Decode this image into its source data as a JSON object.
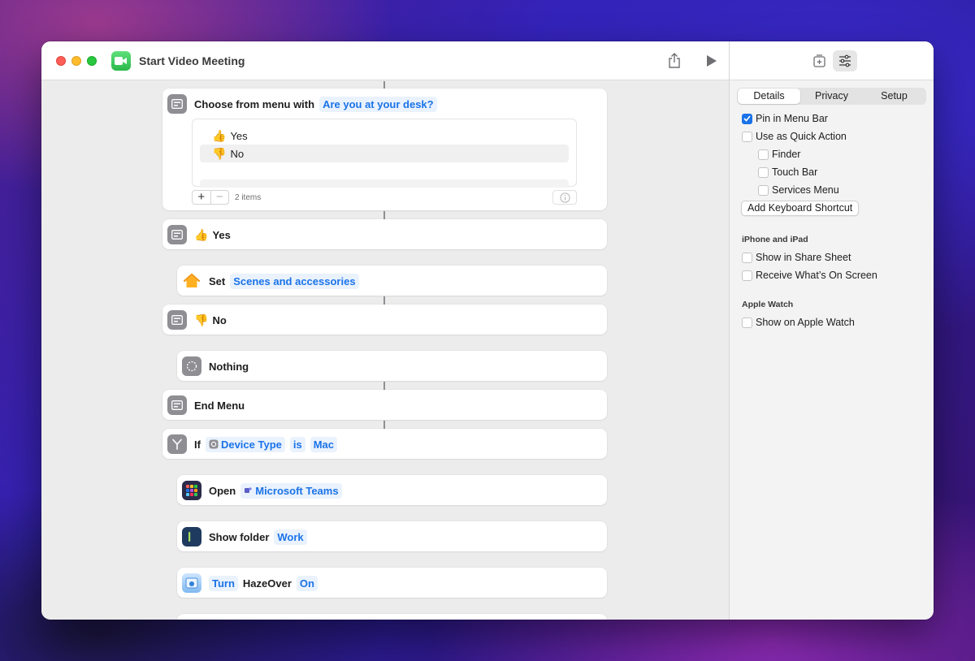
{
  "window": {
    "title": "Start Video Meeting"
  },
  "actions": {
    "menu": {
      "label": "Choose from menu with",
      "prompt": "Are you at your desk?",
      "items": [
        "Yes",
        "No"
      ],
      "count": "2 items"
    },
    "case_yes": {
      "label": "Yes"
    },
    "set": {
      "label": "Set",
      "token": "Scenes and accessories"
    },
    "case_no": {
      "label": "No"
    },
    "nothing": {
      "label": "Nothing"
    },
    "end_menu": {
      "label": "End Menu"
    },
    "if": {
      "label": "If",
      "token1": "Device Type",
      "token2": "is",
      "token3": "Mac"
    },
    "open": {
      "label": "Open",
      "token": "Microsoft Teams"
    },
    "show_folder": {
      "label": "Show folder",
      "token": "Work"
    },
    "turn": {
      "token1": "Turn",
      "label": "HazeOver",
      "token2": "On"
    }
  },
  "emoji": {
    "thumbs_up": "👍",
    "thumbs_down": "👎"
  },
  "sidebar": {
    "tabs": [
      "Details",
      "Privacy",
      "Setup"
    ],
    "active_tab": "Details",
    "options": {
      "pin_menu_bar": {
        "label": "Pin in Menu Bar",
        "checked": true
      },
      "quick_action": {
        "label": "Use as Quick Action",
        "checked": false
      },
      "finder": {
        "label": "Finder",
        "checked": false
      },
      "touch_bar": {
        "label": "Touch Bar",
        "checked": false
      },
      "services_menu": {
        "label": "Services Menu",
        "checked": false
      },
      "share_sheet": {
        "label": "Show in Share Sheet",
        "checked": false
      },
      "on_screen": {
        "label": "Receive What’s On Screen",
        "checked": false
      },
      "apple_watch": {
        "label": "Show on Apple Watch",
        "checked": false
      }
    },
    "add_shortcut_label": "Add Keyboard Shortcut",
    "section_iphone": "iPhone and iPad",
    "section_watch": "Apple Watch"
  },
  "colors": {
    "accent": "#1a73e8",
    "token_bg": "#eaf2fd",
    "action_gray": "#8e8e93",
    "facetime_green": "#2bb84a"
  }
}
